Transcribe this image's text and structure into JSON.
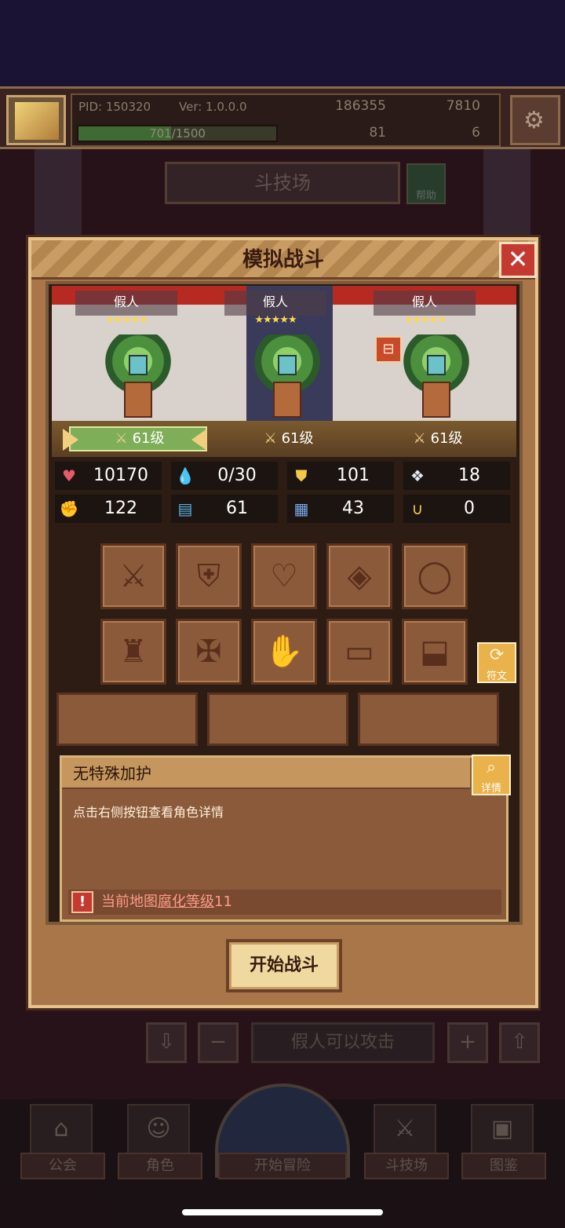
{
  "header": {
    "pid": "PID: 150320",
    "version": "Ver: 1.0.0.0",
    "coins": "186355",
    "gems": "7810",
    "xp": "701/1500",
    "xp_fraction": 0.467,
    "clovers": "81",
    "keys": "6"
  },
  "arena": {
    "title": "斗技场",
    "help_label": "帮助"
  },
  "modal": {
    "title": "模拟战斗",
    "close_label": "✕",
    "enemies": [
      {
        "name": "假人",
        "stars": "★★★★★",
        "level": "61级"
      },
      {
        "name": "假人",
        "stars": "★★★★★",
        "level": "61级"
      },
      {
        "name": "假人",
        "stars": "★★★★★",
        "level": "61级"
      }
    ],
    "stats": [
      {
        "icon": "heart-icon",
        "glyph": "♥",
        "value": "10170",
        "color": "#e85a6a"
      },
      {
        "icon": "mana-drop-icon",
        "glyph": "💧",
        "value": "0/30",
        "color": "#5ab4e8"
      },
      {
        "icon": "shield-icon",
        "glyph": "⛊",
        "value": "101",
        "color": "#f2c94a"
      },
      {
        "icon": "wing-icon",
        "glyph": "❖",
        "value": "18",
        "color": "#e0e8f0"
      },
      {
        "icon": "fist-icon",
        "glyph": "✊",
        "value": "122",
        "color": "#e85a4a"
      },
      {
        "icon": "book-icon",
        "glyph": "▤",
        "value": "61",
        "color": "#5ab4e8"
      },
      {
        "icon": "scroll-icon",
        "glyph": "▦",
        "value": "43",
        "color": "#7aa8e8"
      },
      {
        "icon": "horseshoe-icon",
        "glyph": "∪",
        "value": "0",
        "color": "#f2c94a"
      }
    ],
    "equipment_slots": [
      {
        "name": "sword-slot-icon",
        "glyph": "⚔"
      },
      {
        "name": "shield-slot-icon",
        "glyph": "⛨"
      },
      {
        "name": "amulet-slot-icon",
        "glyph": "♡"
      },
      {
        "name": "orb-slot-icon",
        "glyph": "◈"
      },
      {
        "name": "ring-slot-icon",
        "glyph": "◯"
      },
      {
        "name": "helmet-slot-icon",
        "glyph": "♜"
      },
      {
        "name": "armor-slot-icon",
        "glyph": "✠"
      },
      {
        "name": "gloves-slot-icon",
        "glyph": "✋"
      },
      {
        "name": "belt-slot-icon",
        "glyph": "▭"
      },
      {
        "name": "boots-slot-icon",
        "glyph": "⬓"
      }
    ],
    "rune_label": "符文",
    "blessing_title": "无特殊加护",
    "detail_label": "详情",
    "blessing_text": "点击右侧按钮查看角色详情",
    "warning_prefix": "当前地图",
    "warning_link": "腐化等级",
    "warning_level": "11",
    "start_button": "开始战斗"
  },
  "underlay": {
    "attack_label": "假人可以攻击"
  },
  "nav": {
    "items": [
      {
        "label": "公会",
        "icon": "guild-icon"
      },
      {
        "label": "角色",
        "icon": "character-icon"
      },
      {
        "label": "开始冒险",
        "icon": "adventure-icon"
      },
      {
        "label": "斗技场",
        "icon": "arena-icon"
      },
      {
        "label": "图鉴",
        "icon": "codex-icon"
      }
    ]
  }
}
